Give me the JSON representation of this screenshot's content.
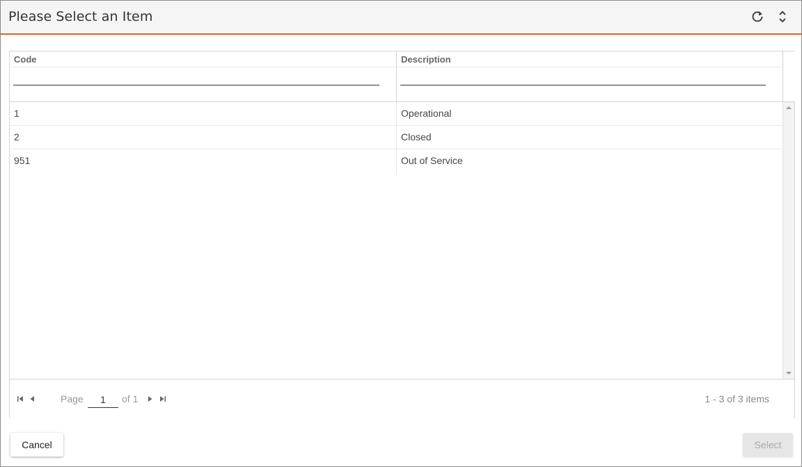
{
  "dialog": {
    "title": "Please Select an Item",
    "refresh_icon": "refresh-icon",
    "expand_icon": "expand-collapse-icon",
    "accent_color": "#e0622c"
  },
  "grid": {
    "columns": [
      {
        "label": "Code",
        "filter_value": ""
      },
      {
        "label": "Description",
        "filter_value": ""
      }
    ],
    "rows": [
      {
        "code": "1",
        "description": "Operational"
      },
      {
        "code": "2",
        "description": "Closed"
      },
      {
        "code": "951",
        "description": "Out of Service"
      }
    ]
  },
  "pager": {
    "page_label": "Page",
    "page_value": "1",
    "of_label": "of 1",
    "info": "1 - 3 of 3 items",
    "first_icon": "first-page-icon",
    "prev_icon": "previous-page-icon",
    "next_icon": "next-page-icon",
    "last_icon": "last-page-icon"
  },
  "footer": {
    "cancel_label": "Cancel",
    "select_label": "Select"
  }
}
